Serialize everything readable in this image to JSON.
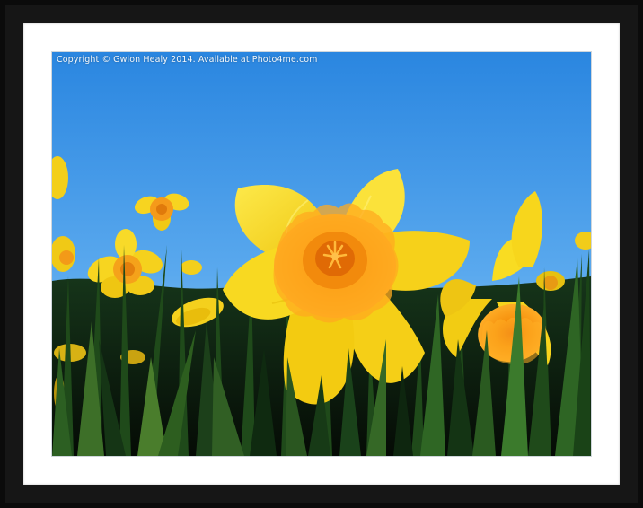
{
  "watermark": {
    "text": "Copyright © Gwion Healy 2014. Available at Photo4me.com"
  },
  "photo": {
    "subject": "daffodils",
    "colors": {
      "sky_top": "#2a86e0",
      "sky_bottom": "#8cc6f2",
      "petal": "#f9dc1e",
      "petal_shade": "#e9c20a",
      "trumpet": "#f8a012",
      "trumpet_edge": "#ffb52e",
      "leaf_dark": "#0c220c",
      "leaf_mid": "#1f4a1a",
      "leaf_light": "#4a7d2c"
    }
  },
  "frame": {
    "frame_color": "#0b0b0b",
    "mount_color": "#ffffff"
  }
}
